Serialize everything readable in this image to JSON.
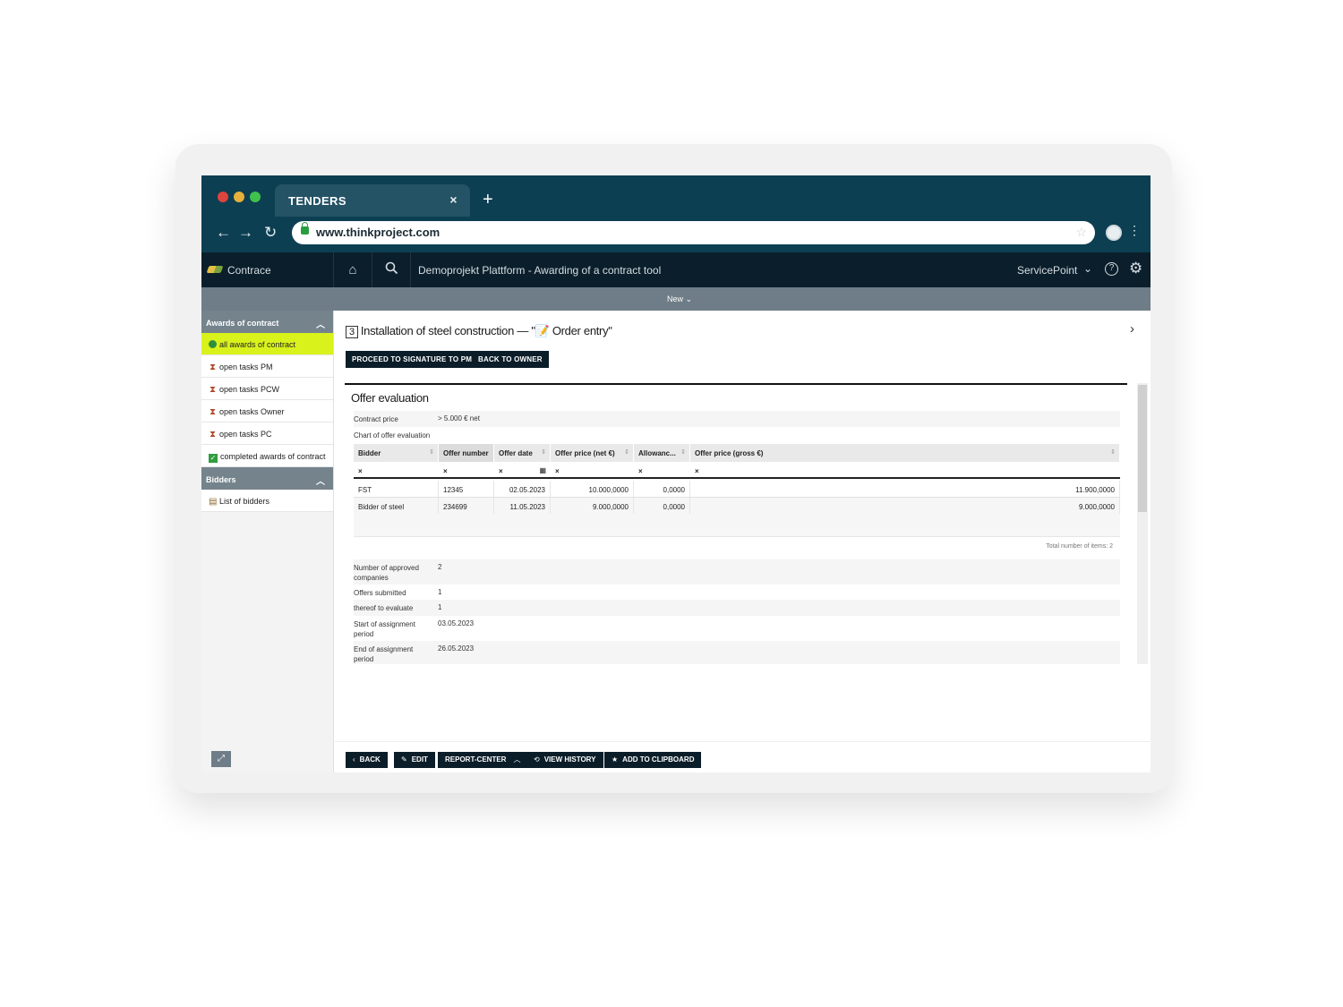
{
  "browser": {
    "dot_colors": [
      "#e0443e",
      "#e7b03a",
      "#3fc24d"
    ],
    "tab_title": "TENDERS",
    "tab_close": "×",
    "new_tab": "+",
    "url": "www.thinkproject.com",
    "nav": {
      "back": "←",
      "forward": "→",
      "reload": "↻"
    }
  },
  "app": {
    "brand": "Contrace",
    "project_title": "Demoprojekt Plattform - Awarding of a contract tool",
    "service_point": "ServicePoint",
    "help": "?",
    "subbar_label": "New ⌄"
  },
  "sidebar": {
    "sections": [
      {
        "title": "Awards of contract",
        "items": [
          {
            "label": "all awards of contract",
            "icon": "status-dot-icon",
            "active": true
          },
          {
            "label": "open tasks PM",
            "icon": "hourglass-icon"
          },
          {
            "label": "open tasks PCW",
            "icon": "hourglass-icon"
          },
          {
            "label": "open tasks Owner",
            "icon": "hourglass-icon"
          },
          {
            "label": "open tasks PC",
            "icon": "hourglass-icon"
          },
          {
            "label": "completed awards of contract",
            "icon": "checkbox-icon"
          }
        ]
      },
      {
        "title": "Bidders",
        "items": [
          {
            "label": "List of bidders",
            "icon": "document-icon"
          }
        ]
      }
    ]
  },
  "main": {
    "step_number": "3",
    "title": "Installation of steel construction — \"📝 Order entry\"",
    "buttons": {
      "proceed": "PROCEED TO SIGNATURE TO PM",
      "back_to_owner": "BACK TO OWNER"
    },
    "panel": {
      "title": "Offer evaluation",
      "contract_price_label": "Contract price",
      "contract_price_value": "> 5.000 € net",
      "chart_label": "Chart of offer evaluation",
      "columns": [
        "Bidder",
        "Offer number",
        "Offer date",
        "Offer price (net €)",
        "Allowanc...",
        "Offer price (gross €)"
      ],
      "filter_clear": "×",
      "rows": [
        [
          "FST",
          "12345",
          "02.05.2023",
          "10.000,0000",
          "0,0000",
          "11.900,0000"
        ],
        [
          "Bidder of steel",
          "234699",
          "11.05.2023",
          "9.000,0000",
          "0,0000",
          "9.000,0000"
        ]
      ],
      "total_items": "Total number of items: 2",
      "stats": [
        {
          "label": "Number of approved companies",
          "value": "2"
        },
        {
          "label": "Offers submitted",
          "value": "1"
        },
        {
          "label": "thereof to evaluate",
          "value": "1"
        },
        {
          "label": "Start of assignment period",
          "value": "03.05.2023"
        },
        {
          "label": "End of assignment period",
          "value": "26.05.2023"
        }
      ]
    },
    "footer": {
      "back": "BACK",
      "edit": "EDIT",
      "report_center": "REPORT-CENTER",
      "view_history": "VIEW HISTORY",
      "add_clipboard": "ADD TO CLIPBOARD"
    }
  }
}
